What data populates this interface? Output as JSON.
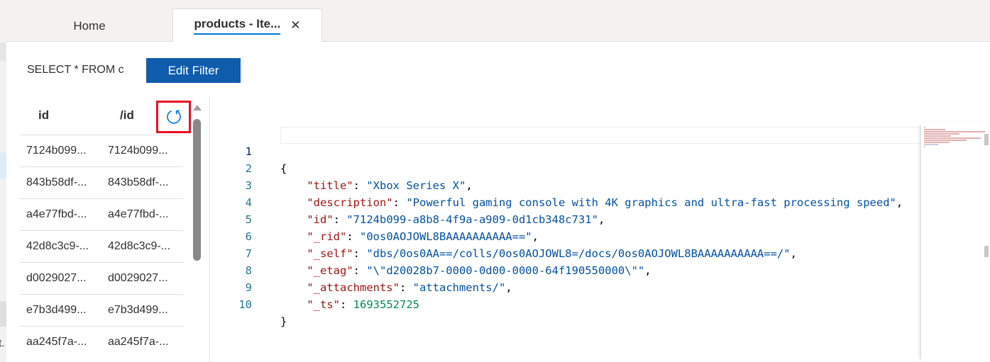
{
  "tabs": {
    "home": "Home",
    "products": "products - Ite...",
    "close_glyph": "✕"
  },
  "query": {
    "text": "SELECT * FROM c",
    "edit_filter_label": "Edit Filter"
  },
  "list": {
    "headers": {
      "id": "id",
      "partition_key": "/id"
    },
    "rows": [
      {
        "id": "7124b099...",
        "pk": "7124b099..."
      },
      {
        "id": "843b58df-...",
        "pk": "843b58df-..."
      },
      {
        "id": "a4e77fbd-...",
        "pk": "a4e77fbd-..."
      },
      {
        "id": "42d8c3c9-...",
        "pk": "42d8c3c9-..."
      },
      {
        "id": "d0029027...",
        "pk": "d0029027..."
      },
      {
        "id": "e7b3d499...",
        "pk": "e7b3d499..."
      },
      {
        "id": "aa245f7a-...",
        "pk": "aa245f7a-..."
      }
    ]
  },
  "editor": {
    "line_numbers": [
      "1",
      "2",
      "3",
      "4",
      "5",
      "6",
      "7",
      "8",
      "9",
      "10"
    ],
    "lines": [
      {
        "open": "{"
      },
      {
        "key": "\"title\"",
        "val": "\"Xbox Series X\"",
        "tail": ","
      },
      {
        "key": "\"description\"",
        "val": "\"Powerful gaming console with 4K graphics and ultra-fast processing speed\"",
        "tail": ","
      },
      {
        "key": "\"id\"",
        "val": "\"7124b099-a8b8-4f9a-a909-0d1cb348c731\"",
        "tail": ","
      },
      {
        "key": "\"_rid\"",
        "val": "\"0os0AOJOWL8BAAAAAAAAAA==\"",
        "tail": ","
      },
      {
        "key": "\"_self\"",
        "val": "\"dbs/0os0AA==/colls/0os0AOJOWL8=/docs/0os0AOJOWL8BAAAAAAAAAA==/\"",
        "tail": ","
      },
      {
        "key": "\"_etag\"",
        "val": "\"\\\"d20028b7-0000-0d00-0000-64f190550000\\\"\"",
        "tail": ","
      },
      {
        "key": "\"_attachments\"",
        "val": "\"attachments/\"",
        "tail": ","
      },
      {
        "key": "\"_ts\"",
        "num": "1693552725",
        "tail": ""
      },
      {
        "close": "}"
      }
    ]
  },
  "left_strip_glyph": "t."
}
